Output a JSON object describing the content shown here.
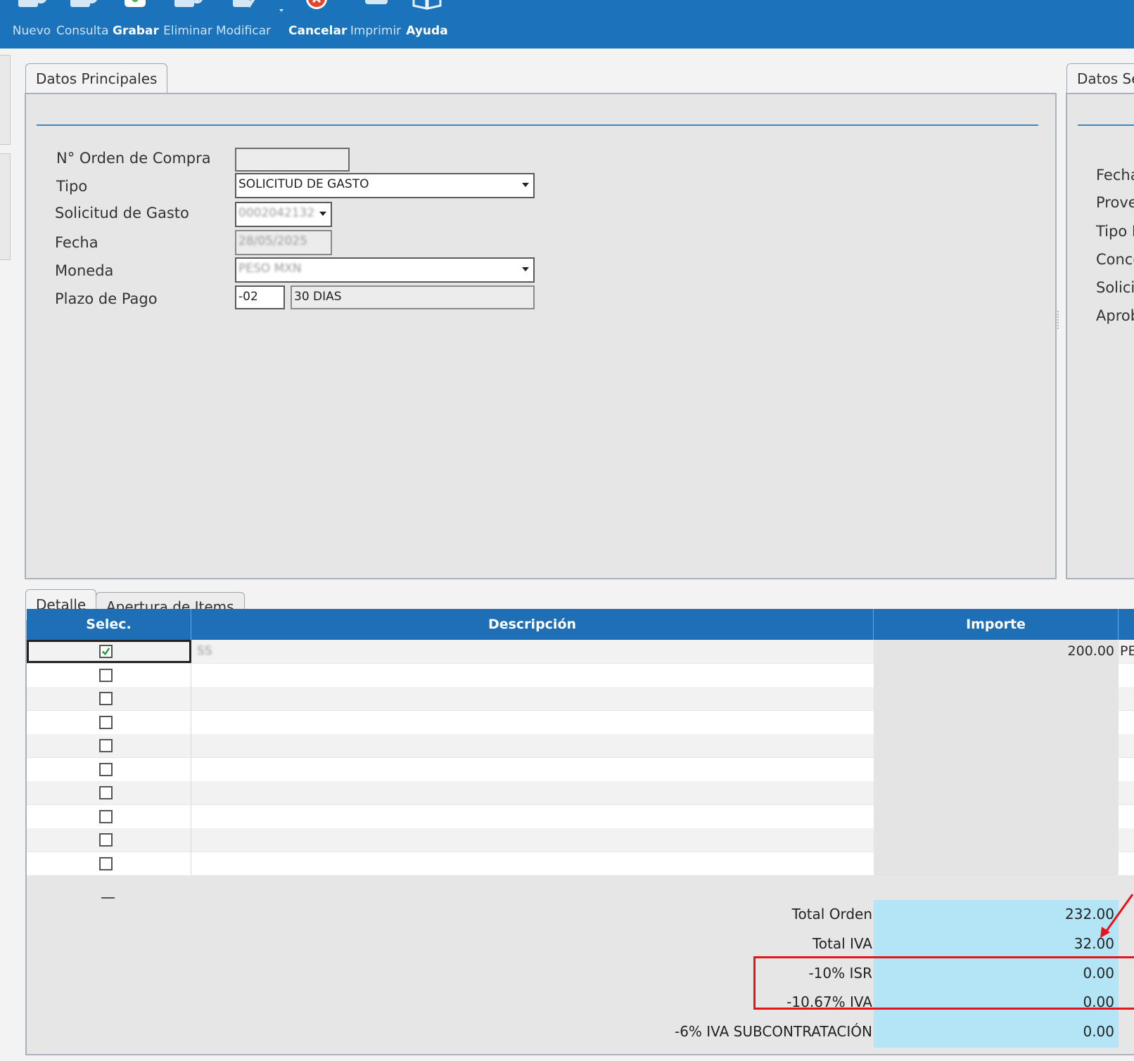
{
  "toolbar": {
    "buttons": [
      {
        "label": "Nuevo"
      },
      {
        "label": "Consulta"
      },
      {
        "label": "Grabar"
      },
      {
        "label": "Eliminar"
      },
      {
        "label": "Modificar"
      },
      {
        "label": "Cancelar"
      },
      {
        "label": "Imprimir"
      },
      {
        "label": "Ayuda"
      }
    ]
  },
  "main_panel": {
    "tab_label": "Datos Principales",
    "fields": {
      "orden_label": "N° Orden de Compra",
      "orden_value": "",
      "tipo_label": "Tipo",
      "tipo_value": "SOLICITUD DE GASTO",
      "solicitud_label": "Solicitud de Gasto",
      "solicitud_value": "0002042132",
      "fecha_label": "Fecha",
      "fecha_value": "28/05/2025",
      "moneda_label": "Moneda",
      "moneda_value": "PESO MXN",
      "plazo_label": "Plazo de Pago",
      "plazo_code": "-02",
      "plazo_desc": "30 DIAS"
    }
  },
  "secondary_panel": {
    "tab_label": "Datos Se",
    "labels": [
      "Fecha",
      "Prove",
      "Tipo I",
      "Conce",
      "Solici",
      "Aprob"
    ]
  },
  "detail": {
    "tabs": [
      {
        "label": "Detalle"
      },
      {
        "label": "Apertura de Items"
      }
    ],
    "columns": [
      "Selec.",
      "Descripción",
      "Importe"
    ],
    "rows": [
      {
        "checked": true,
        "description": "SS",
        "importe": "200.00",
        "extra": "PE"
      },
      {
        "checked": false
      },
      {
        "checked": false
      },
      {
        "checked": false
      },
      {
        "checked": false
      },
      {
        "checked": false
      },
      {
        "checked": false
      },
      {
        "checked": false
      },
      {
        "checked": false
      },
      {
        "checked": false
      }
    ],
    "totals": [
      {
        "label": "Total Orden",
        "value": "232.00"
      },
      {
        "label": "Total IVA",
        "value": "32.00"
      },
      {
        "label": "-10% ISR",
        "value": "0.00"
      },
      {
        "label": "-10.67% IVA",
        "value": "0.00"
      },
      {
        "label": "-6% IVA SUBCONTRATACIÓN",
        "value": "0.00"
      }
    ]
  },
  "colors": {
    "toolbar": "#1a73bb",
    "grid_header": "#1e6fb6",
    "totals_bg": "#b3e5f7",
    "highlight": "#e8121a"
  }
}
